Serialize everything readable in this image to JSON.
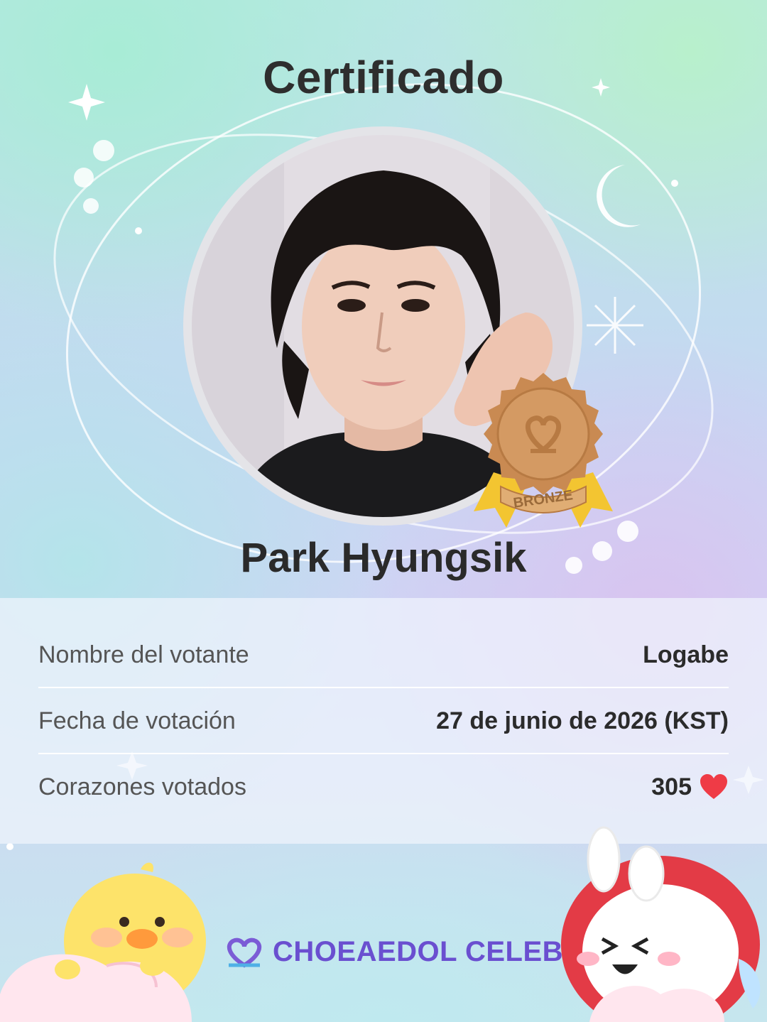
{
  "certificate": {
    "title": "Certificado",
    "celebrity_name": "Park Hyungsik",
    "medal_label": "BRONZE",
    "medal_color": "#c98a52"
  },
  "info": {
    "rows": [
      {
        "label": "Nombre del votante",
        "value": "Logabe"
      },
      {
        "label": "Fecha de votación",
        "value": "27 de junio de 2026 (KST)"
      },
      {
        "label": "Corazones votados",
        "value": "305",
        "icon": "heart-icon"
      }
    ]
  },
  "brand": {
    "name": "CHOEAEDOL CELEB",
    "logo_icon": "double-heart-logo-icon",
    "accent_color": "#6a4fd0"
  }
}
